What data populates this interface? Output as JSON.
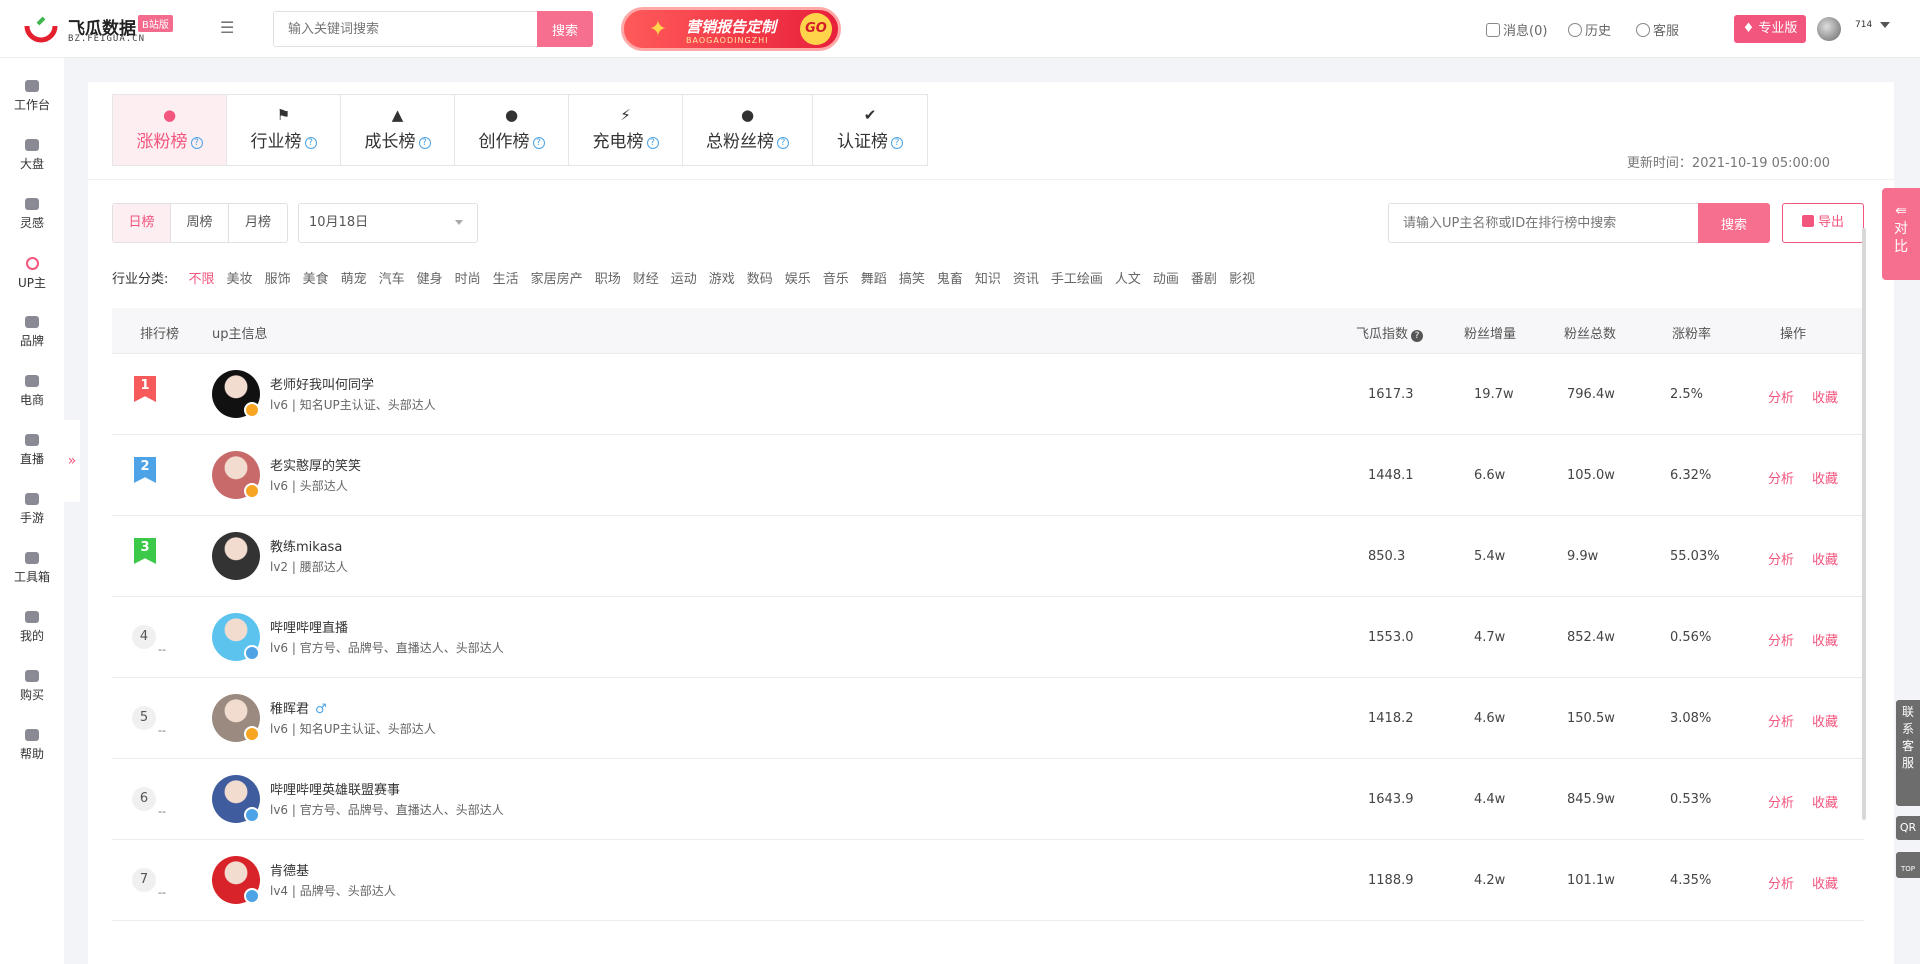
{
  "brand": {
    "title": "飞瓜数据",
    "badge": "B站版",
    "sub": "BZ.FEIGUA.CN",
    "colors": {
      "accent": "#f2557d",
      "search": "#f76f8f"
    }
  },
  "header": {
    "search_placeholder": "输入关键词搜索",
    "search_label": "搜索",
    "promo_title": "营销报告定制",
    "promo_sub": "BAOGAODINGZHI",
    "promo_go": "GO",
    "messages": "消息(0)",
    "history": "历史",
    "service": "客服",
    "pro": "专业版",
    "user_num": "714"
  },
  "sidebar": {
    "items": [
      {
        "label": "工作台",
        "icon": "home-icon"
      },
      {
        "label": "大盘",
        "icon": "pie-chart-icon"
      },
      {
        "label": "灵感",
        "icon": "bulb-icon"
      },
      {
        "label": "UP主",
        "icon": "search-icon"
      },
      {
        "label": "品牌",
        "icon": "diamond-icon"
      },
      {
        "label": "电商",
        "icon": "cart-icon"
      },
      {
        "label": "直播",
        "icon": "tv-icon"
      },
      {
        "label": "手游",
        "icon": "gamepad-icon"
      },
      {
        "label": "工具箱",
        "icon": "toolbox-icon"
      },
      {
        "label": "我的",
        "icon": "user-icon"
      },
      {
        "label": "购买",
        "icon": "card-icon"
      },
      {
        "label": "帮助",
        "icon": "help-icon"
      }
    ],
    "active": "UP主",
    "expander": "»"
  },
  "tabs": [
    {
      "label": "涨粉榜",
      "icon": "user-up-icon",
      "active": true
    },
    {
      "label": "行业榜",
      "icon": "flag-icon"
    },
    {
      "label": "成长榜",
      "icon": "growth-icon"
    },
    {
      "label": "创作榜",
      "icon": "bulb-icon"
    },
    {
      "label": "充电榜",
      "icon": "lightning-icon"
    },
    {
      "label": "总粉丝榜",
      "icon": "users-icon"
    },
    {
      "label": "认证榜",
      "icon": "verified-icon"
    }
  ],
  "update_time": "更新时间：2021-10-19 05:00:00",
  "period": {
    "options": [
      "日榜",
      "周榜",
      "月榜"
    ],
    "active": "日榜",
    "date": "10月18日"
  },
  "up_search": {
    "placeholder": "请输入UP主名称或ID在排行榜中搜索",
    "button": "搜索",
    "export": "导出"
  },
  "categories": {
    "label": "行业分类:",
    "items": [
      "不限",
      "美妆",
      "服饰",
      "美食",
      "萌宠",
      "汽车",
      "健身",
      "时尚",
      "生活",
      "家居房产",
      "职场",
      "财经",
      "运动",
      "游戏",
      "数码",
      "娱乐",
      "音乐",
      "舞蹈",
      "搞笑",
      "鬼畜",
      "知识",
      "资讯",
      "手工绘画",
      "人文",
      "动画",
      "番剧",
      "影视"
    ],
    "active": "不限"
  },
  "table": {
    "headers": {
      "rank": "排行榜",
      "info": "up主信息",
      "index": "飞瓜指数",
      "gain": "粉丝增量",
      "total": "粉丝总数",
      "rate": "涨粉率",
      "op": "操作"
    },
    "ops": {
      "analyze": "分析",
      "favorite": "收藏"
    },
    "rows": [
      {
        "rank": "1",
        "name": "老师好我叫何同学",
        "tags": "lv6 | 知名UP主认证、头部达人",
        "index": "1617.3",
        "gain": "19.7w",
        "total": "796.4w",
        "rate": "2.5%",
        "badge_color": "#f75a5a",
        "avatar": "#111111",
        "mark": "#f6a623"
      },
      {
        "rank": "2",
        "name": "老实憨厚的笑笑",
        "tags": "lv6 | 头部达人",
        "index": "1448.1",
        "gain": "6.6w",
        "total": "105.0w",
        "rate": "6.32%",
        "badge_color": "#4da3e6",
        "avatar": "#c96a6a",
        "mark": "#f6a623"
      },
      {
        "rank": "3",
        "name": "教练mikasa",
        "tags": "lv2 | 腰部达人",
        "index": "850.3",
        "gain": "5.4w",
        "total": "9.9w",
        "rate": "55.03%",
        "badge_color": "#3cc94a",
        "avatar": "#333333",
        "mark": ""
      },
      {
        "rank": "4",
        "name": "哔哩哔哩直播",
        "tags": "lv6 | 官方号、品牌号、直播达人、头部达人",
        "index": "1553.0",
        "gain": "4.7w",
        "total": "852.4w",
        "rate": "0.56%",
        "dash": "--",
        "avatar": "#5cc3ee",
        "mark": "#4da3e6"
      },
      {
        "rank": "5",
        "name": "稚晖君",
        "gender": "♂",
        "tags": "lv6 | 知名UP主认证、头部达人",
        "index": "1418.2",
        "gain": "4.6w",
        "total": "150.5w",
        "rate": "3.08%",
        "dash": "--",
        "avatar": "#9a8a80",
        "mark": "#f6a623"
      },
      {
        "rank": "6",
        "name": "哔哩哔哩英雄联盟赛事",
        "tags": "lv6 | 官方号、品牌号、直播达人、头部达人",
        "index": "1643.9",
        "gain": "4.4w",
        "total": "845.9w",
        "rate": "0.53%",
        "dash": "--",
        "avatar": "#3f5c9e",
        "mark": "#4da3e6"
      },
      {
        "rank": "7",
        "name": "肯德基",
        "tags": "lv4 | 品牌号、头部达人",
        "index": "1188.9",
        "gain": "4.2w",
        "total": "101.1w",
        "rate": "4.35%",
        "dash": "--",
        "avatar": "#d8232a",
        "mark": "#4da3e6"
      }
    ]
  },
  "float": {
    "compare": "对比",
    "service": "联系客服",
    "qr": "QR",
    "top": "TOP"
  }
}
